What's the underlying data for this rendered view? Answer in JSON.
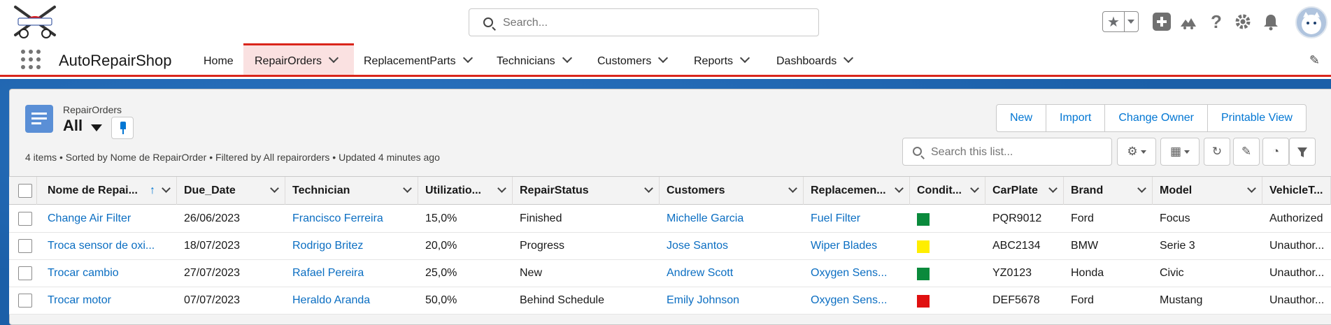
{
  "global": {
    "search_placeholder": "Search...",
    "logo_text": "AUTO REPAIR"
  },
  "nav": {
    "app_name": "AutoRepairShop",
    "tabs": [
      {
        "label": "Home",
        "has_menu": false
      },
      {
        "label": "RepairOrders",
        "has_menu": true,
        "active": true
      },
      {
        "label": "ReplacementParts",
        "has_menu": true
      },
      {
        "label": "Technicians",
        "has_menu": true
      },
      {
        "label": "Customers",
        "has_menu": true
      },
      {
        "label": "Reports",
        "has_menu": true
      },
      {
        "label": "Dashboards",
        "has_menu": true
      }
    ]
  },
  "list_view": {
    "object_label": "RepairOrders",
    "view_name": "All",
    "meta": "4 items • Sorted by Nome de RepairOrder • Filtered by All repairorders • Updated 4 minutes ago",
    "buttons": {
      "new": "New",
      "import": "Import",
      "change_owner": "Change Owner",
      "printable_view": "Printable View"
    },
    "search_placeholder": "Search this list..."
  },
  "table": {
    "columns": [
      "Nome de Repai...",
      "Due_Date",
      "Technician",
      "Utilizatio...",
      "RepairStatus",
      "Customers",
      "Replacemen...",
      "Condit...",
      "CarPlate",
      "Brand",
      "Model",
      "VehicleT..."
    ],
    "rows": [
      {
        "name": "Change Air Filter",
        "due_date": "26/06/2023",
        "technician": "Francisco Ferreira",
        "utilization": "15,0%",
        "status": "Finished",
        "customer": "Michelle Garcia",
        "part": "Fuel Filter",
        "condition_color": "#0a8a3c",
        "plate": "PQR9012",
        "brand": "Ford",
        "model": "Focus",
        "vehicle_type": "Authorized"
      },
      {
        "name": "Troca sensor de oxi...",
        "due_date": "18/07/2023",
        "technician": "Rodrigo Britez",
        "utilization": "20,0%",
        "status": "Progress",
        "customer": "Jose Santos",
        "part": "Wiper Blades",
        "condition_color": "#ffee00",
        "plate": "ABC2134",
        "brand": "BMW",
        "model": "Serie 3",
        "vehicle_type": "Unauthor..."
      },
      {
        "name": "Trocar cambio",
        "due_date": "27/07/2023",
        "technician": "Rafael Pereira",
        "utilization": "25,0%",
        "status": "New",
        "customer": "Andrew Scott",
        "part": "Oxygen Sens...",
        "condition_color": "#0a8a3c",
        "plate": "YZ0123",
        "brand": "Honda",
        "model": "Civic",
        "vehicle_type": "Unauthor..."
      },
      {
        "name": "Trocar motor",
        "due_date": "07/07/2023",
        "technician": "Heraldo Aranda",
        "utilization": "50,0%",
        "status": "Behind Schedule",
        "customer": "Emily Johnson",
        "part": "Oxygen Sens...",
        "condition_color": "#e01010",
        "plate": "DEF5678",
        "brand": "Ford",
        "model": "Mustang",
        "vehicle_type": "Unauthor..."
      }
    ]
  }
}
